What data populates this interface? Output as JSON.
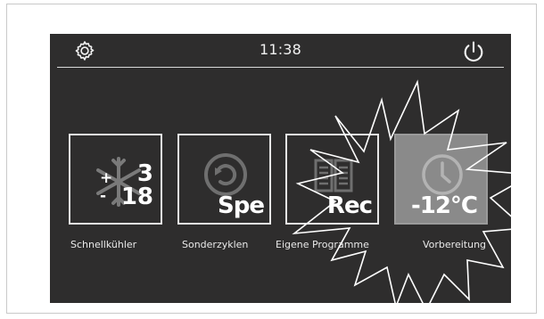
{
  "header": {
    "time": "11:38"
  },
  "tiles": [
    {
      "label": "Schnellkühler",
      "line1": "3",
      "line2": "18",
      "sign1": "+",
      "sign2": "-"
    },
    {
      "label": "Sonderzyklen",
      "tag": "Spe"
    },
    {
      "label": "Eigene Programme",
      "tag": "Rec"
    },
    {
      "label": "Vorbereitung",
      "tag": "-12°C"
    }
  ],
  "colors": {
    "screen_bg": "#2e2d2d",
    "tile_border": "#e7e7e7",
    "selected_tile_bg": "#8a8a8a"
  }
}
